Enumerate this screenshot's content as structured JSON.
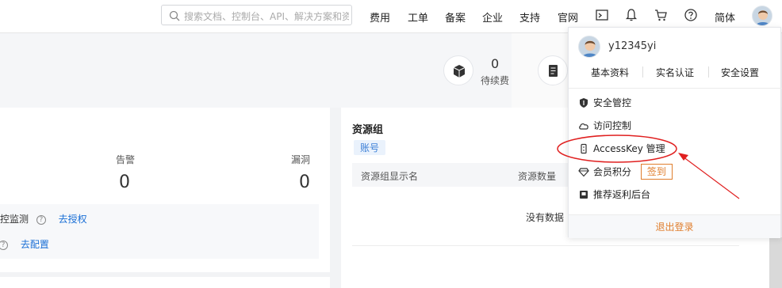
{
  "header": {
    "search_placeholder": "搜索文档、控制台、API、解决方案和资源",
    "nav": [
      "费用",
      "工单",
      "备案",
      "企业",
      "支持",
      "官网"
    ],
    "lang": "简体",
    "icons": [
      "console-icon",
      "bell-icon",
      "cart-icon",
      "help-icon"
    ]
  },
  "banner": {
    "renewal_count": "0",
    "renewal_label": "待续费"
  },
  "security_card": {
    "alert_label": "告警",
    "alert_count": "0",
    "vuln_label": "漏洞",
    "vuln_count": "0",
    "row1_text": "控监测",
    "row1_link": "去授权",
    "row2_link": "去配置"
  },
  "resource_group": {
    "title": "资源组",
    "tag": "账号",
    "col_name": "资源组显示名",
    "col_count": "资源数量",
    "empty": "没有数据"
  },
  "dropdown": {
    "username": "y12345yi",
    "tabs": [
      "基本资料",
      "实名认证",
      "安全设置"
    ],
    "items": [
      "安全管控",
      "访问控制",
      "AccessKey 管理",
      "会员积分",
      "推荐返利后台"
    ],
    "signin": "签到",
    "logout": "退出登录"
  },
  "colors": {
    "accent_orange": "#e07e2d",
    "link_blue": "#1a6fd6",
    "annotation_red": "#e02020"
  }
}
